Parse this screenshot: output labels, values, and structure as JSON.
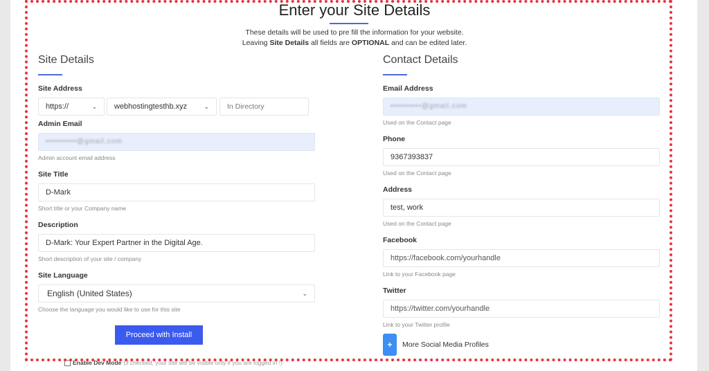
{
  "header": {
    "title": "Enter your Site Details",
    "intro_line1": "These details will be used to pre fill the information for your website.",
    "intro_line2_pre": "Leaving ",
    "intro_line2_bold1": "Site Details",
    "intro_line2_mid": " all fields are ",
    "intro_line2_bold2": "OPTIONAL",
    "intro_line2_post": " and can be edited later."
  },
  "site_details": {
    "section_title": "Site Details",
    "site_address": {
      "label": "Site Address",
      "protocol": "https://",
      "domain": "webhostingtesthb.xyz",
      "directory_placeholder": "In Directory"
    },
    "admin_email": {
      "label": "Admin Email",
      "value": "••••••••••@gmail.com",
      "hint": "Admin account email address"
    },
    "site_title": {
      "label": "Site Title",
      "value": "D-Mark",
      "hint": "Short title or your Company name"
    },
    "description": {
      "label": "Description",
      "value": "D-Mark: Your Expert Partner in the Digital Age.",
      "hint": "Short description of your site / company"
    },
    "site_language": {
      "label": "Site Language",
      "value": "English (United States)",
      "hint": "Choose the language you would like to use for this site"
    },
    "proceed_button": "Proceed with Install"
  },
  "contact_details": {
    "section_title": "Contact Details",
    "email": {
      "label": "Email Address",
      "value": "••••••••••@gmail.com",
      "hint": "Used on the Contact page"
    },
    "phone": {
      "label": "Phone",
      "value": "9367393837",
      "hint": "Used on the Contact page"
    },
    "address": {
      "label": "Address",
      "value": "test, work",
      "hint": "Used on the Contact page"
    },
    "facebook": {
      "label": "Facebook",
      "placeholder": "https://facebook.com/yourhandle",
      "hint": "Link to your Facebook page"
    },
    "twitter": {
      "label": "Twitter",
      "placeholder": "https://twitter.com/yourhandle",
      "hint": "Link to your Twitter profile"
    },
    "more_social": {
      "icon": "plus",
      "label": "More Social Media Profiles"
    }
  },
  "dev_mode": {
    "checked": false,
    "label": "Enable Dev Mode",
    "note": "(if checked, your site will be visible only if you are logged in !)"
  },
  "colors": {
    "accent": "#3b5bef",
    "underline": "#4a6bd6",
    "plus_button": "#3d8ef5",
    "highlight_border": "#e8313a",
    "autofill_bg": "#e8eefb"
  }
}
